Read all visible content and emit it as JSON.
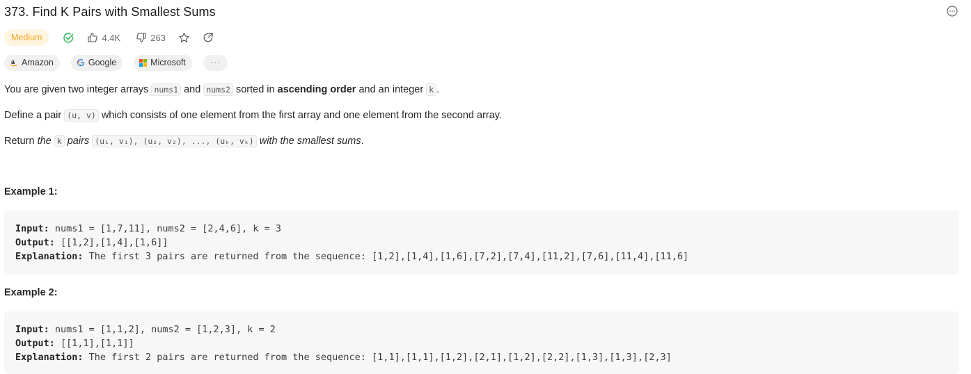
{
  "problem": {
    "title": "373. Find K Pairs with Smallest Sums",
    "difficulty": "Medium",
    "likes": "4.4K",
    "dislikes": "263"
  },
  "tags": [
    {
      "label": "Amazon",
      "icon": "amazon-logo-icon"
    },
    {
      "label": "Google",
      "icon": "google-logo-icon"
    },
    {
      "label": "Microsoft",
      "icon": "microsoft-logo-icon"
    },
    {
      "label": "···",
      "icon": "more-icon"
    }
  ],
  "description": {
    "p1": {
      "a": "You are given two integer arrays ",
      "c1": "nums1",
      "b": " and ",
      "c2": "nums2",
      "c": " sorted in ",
      "bold": "ascending order",
      "d": " and an integer ",
      "c3": "k",
      "e": "."
    },
    "p2": {
      "a": "Define a pair ",
      "c1": "(u, v)",
      "b": " which consists of one element from the first array and one element from the second array."
    },
    "p3": {
      "a": "Return ",
      "i1": "the",
      "c1": "k",
      "i2": "pairs",
      "c2": "(u₁, v₁), (u₂, v₂), ..., (uₖ, vₖ)",
      "i3": "with the smallest sums",
      "e": "."
    }
  },
  "examples": [
    {
      "title": "Example 1:",
      "input_label": "Input:",
      "input": " nums1 = [1,7,11], nums2 = [2,4,6], k = 3",
      "output_label": "Output:",
      "output": " [[1,2],[1,4],[1,6]]",
      "explanation_label": "Explanation:",
      "explanation": " The first 3 pairs are returned from the sequence: [1,2],[1,4],[1,6],[7,2],[7,4],[11,2],[7,6],[11,4],[11,6]"
    },
    {
      "title": "Example 2:",
      "input_label": "Input:",
      "input": " nums1 = [1,1,2], nums2 = [1,2,3], k = 2",
      "output_label": "Output:",
      "output": " [[1,1],[1,1]]",
      "explanation_label": "Explanation:",
      "explanation": " The first 2 pairs are returned from the sequence: [1,1],[1,1],[1,2],[2,1],[1,2],[2,2],[1,3],[1,3],[2,3]"
    }
  ],
  "colors": {
    "difficulty_bg": "#fff4e0",
    "difficulty_text": "#f5a623",
    "solved_check": "#2cbb5d",
    "code_bg": "#f5f5f5",
    "example_bg": "#f7f7f7"
  }
}
